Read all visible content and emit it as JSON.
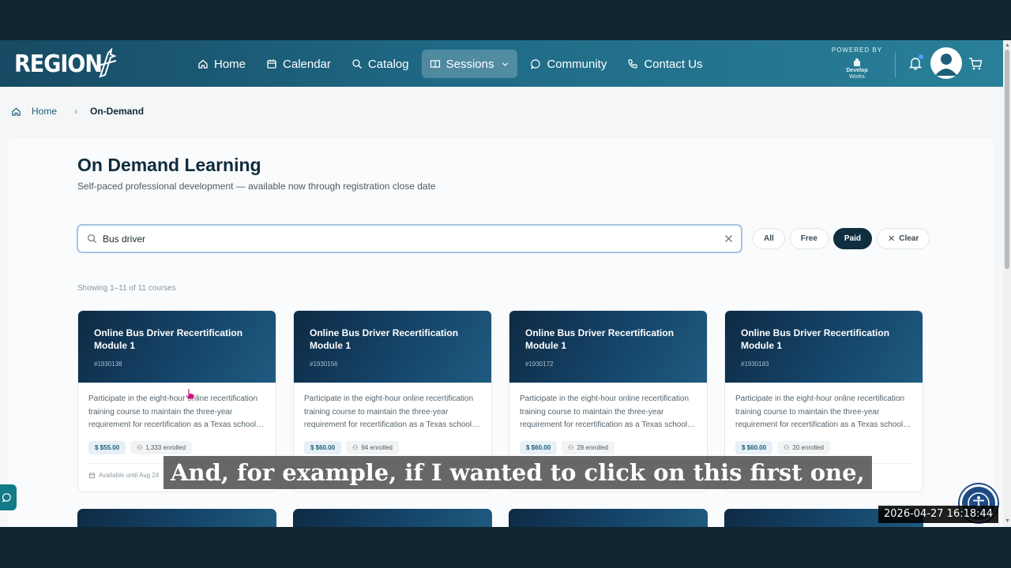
{
  "header": {
    "logo_text": "REGION",
    "nav": [
      {
        "label": "Home",
        "icon": "home-icon"
      },
      {
        "label": "Calendar",
        "icon": "calendar-icon"
      },
      {
        "label": "Catalog",
        "icon": "search-icon"
      },
      {
        "label": "Sessions",
        "icon": "book-icon",
        "active": true
      },
      {
        "label": "Community",
        "icon": "chat-icon"
      },
      {
        "label": "Contact Us",
        "icon": "phone-icon"
      }
    ],
    "powered_by": "POWERED BY",
    "powered_brand_1": "Develop",
    "powered_brand_2": "Works"
  },
  "breadcrumb": {
    "home": "Home",
    "current": "On-Demand"
  },
  "page": {
    "title": "On Demand Learning",
    "subtitle": "Self-paced professional development — available now through registration close date"
  },
  "search": {
    "value": "Bus driver",
    "placeholder": ""
  },
  "filters": {
    "all": "All",
    "free": "Free",
    "paid": "Paid",
    "clear": "Clear",
    "active": "Paid"
  },
  "results": {
    "showing": "Showing 1–11 of 11 courses"
  },
  "cards": [
    {
      "title": "Online Bus Driver Recertification Module 1",
      "id": "#1930138",
      "desc": "Participate in the eight-hour online recertification training course to maintain the three-year requirement for recertification as a Texas school…",
      "price": "$ $55.00",
      "enrolled": "1,333 enrolled",
      "available": "Available until Aug 24"
    },
    {
      "title": "Online Bus Driver Recertification Module 1",
      "id": "#1930156",
      "desc": "Participate in the eight-hour online recertification training course to maintain the three-year requirement for recertification as a Texas school…",
      "price": "$ $60.00",
      "enrolled": "94 enrolled",
      "available": ""
    },
    {
      "title": "Online Bus Driver Recertification Module 1",
      "id": "#1930172",
      "desc": "Participate in the eight-hour online recertification training course to maintain the three-year requirement for recertification as a Texas school…",
      "price": "$ $60.00",
      "enrolled": "28 enrolled",
      "available": ""
    },
    {
      "title": "Online Bus Driver Recertification Module 1",
      "id": "#1930183",
      "desc": "Participate in the eight-hour online recertification training course to maintain the three-year requirement for recertification as a Texas school…",
      "price": "$ $60.00",
      "enrolled": "20 enrolled",
      "available": ""
    }
  ],
  "overlay": {
    "caption": "And, for example, if I wanted to click on this first one,",
    "timestamp": "2026-04-27  16:18:44"
  },
  "colors": {
    "header_start": "#174a63",
    "header_end": "#2a7f98",
    "card_top": "#0e2a44",
    "chip_active": "#0f2f40",
    "search_border": "#a8c3e3"
  }
}
